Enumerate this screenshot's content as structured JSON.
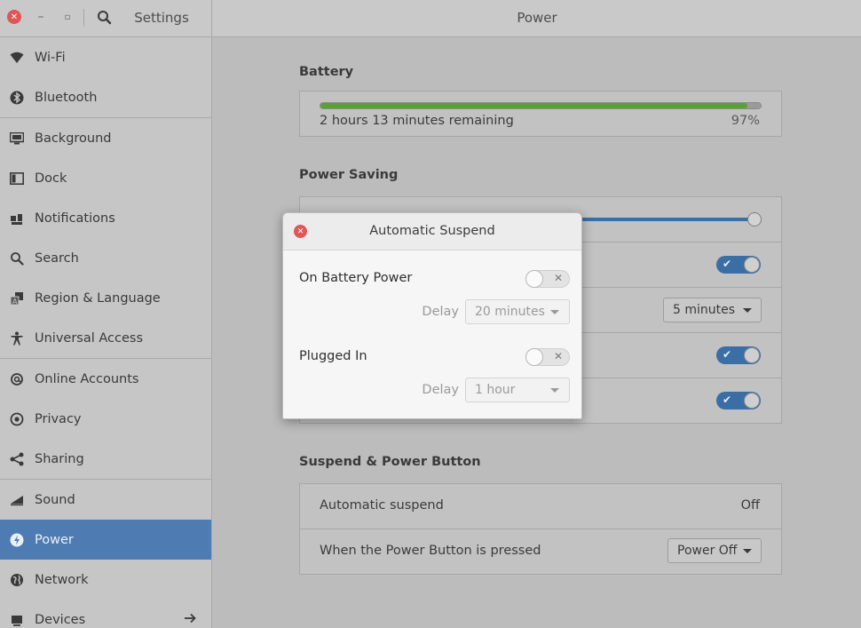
{
  "window": {
    "app_title": "Settings",
    "page_title": "Power"
  },
  "sidebar": {
    "items": [
      {
        "label": "Wi-Fi",
        "icon": "wifi-icon"
      },
      {
        "label": "Bluetooth",
        "icon": "bluetooth-icon"
      },
      {
        "label": "Background",
        "icon": "monitor-icon"
      },
      {
        "label": "Dock",
        "icon": "dock-icon"
      },
      {
        "label": "Notifications",
        "icon": "bell-icon"
      },
      {
        "label": "Search",
        "icon": "search-icon"
      },
      {
        "label": "Region & Language",
        "icon": "language-icon"
      },
      {
        "label": "Universal Access",
        "icon": "accessibility-icon"
      },
      {
        "label": "Online Accounts",
        "icon": "at-icon"
      },
      {
        "label": "Privacy",
        "icon": "privacy-icon"
      },
      {
        "label": "Sharing",
        "icon": "share-icon"
      },
      {
        "label": "Sound",
        "icon": "volume-icon"
      },
      {
        "label": "Power",
        "icon": "power-icon"
      },
      {
        "label": "Network",
        "icon": "globe-icon"
      },
      {
        "label": "Devices",
        "icon": "devices-icon"
      }
    ],
    "active": "Power"
  },
  "battery": {
    "section_title": "Battery",
    "remaining": "2 hours 13 minutes remaining",
    "percent_text": "97%",
    "level": 0.97,
    "bar_color": "#5aa135"
  },
  "power_saving": {
    "section_title": "Power Saving",
    "blank_screen_value": "5 minutes"
  },
  "suspend": {
    "section_title": "Suspend & Power Button",
    "automatic_suspend_label": "Automatic suspend",
    "automatic_suspend_value": "Off",
    "power_button_label": "When the Power Button is pressed",
    "power_button_value": "Power Off"
  },
  "dialog": {
    "title": "Automatic Suspend",
    "battery_label": "On Battery Power",
    "battery_delay_label": "Delay",
    "battery_delay_value": "20 minutes",
    "plugged_label": "Plugged In",
    "plugged_delay_label": "Delay",
    "plugged_delay_value": "1 hour"
  },
  "colors": {
    "accent": "#4e7cb2",
    "switch_on": "#3a6ea5",
    "close_button": "#e05555"
  }
}
